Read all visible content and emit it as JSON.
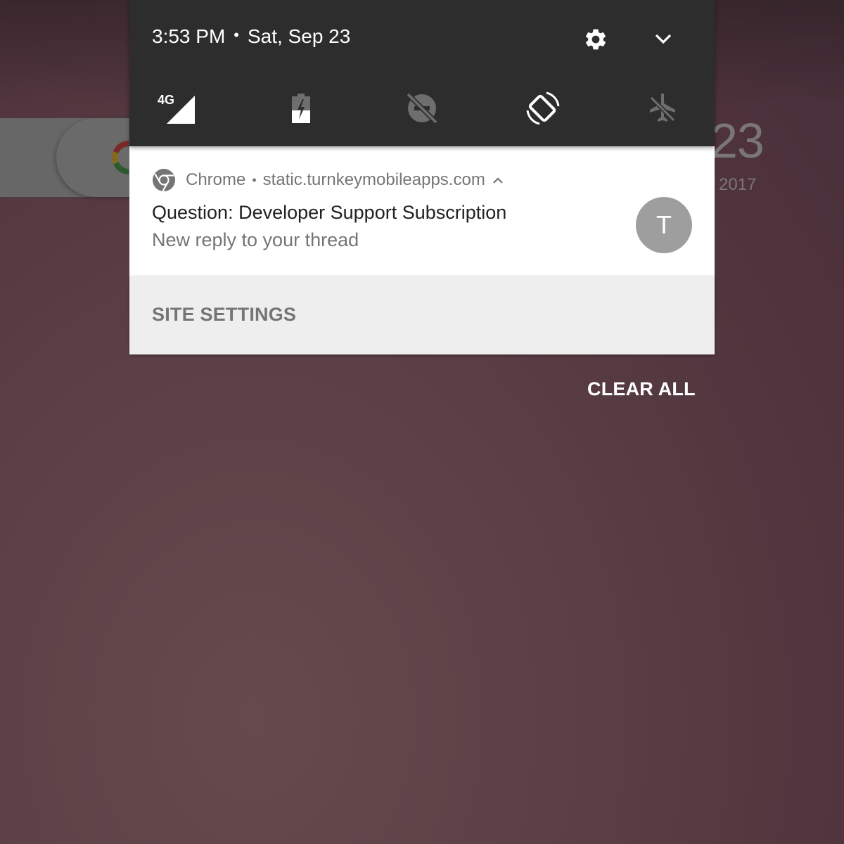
{
  "home": {
    "clock_partial": "23",
    "date_partial": "2017"
  },
  "shade": {
    "time": "3:53 PM",
    "separator": "•",
    "date": "Sat, Sep 23",
    "settings_icon": "gear-icon",
    "expand_icon": "chevron-down-icon",
    "quick_settings": [
      {
        "name": "mobile-data",
        "icon": "signal-4g-icon",
        "label": "4G",
        "state": "on"
      },
      {
        "name": "battery-saver",
        "icon": "battery-charging-icon",
        "state": "off"
      },
      {
        "name": "do-not-disturb",
        "icon": "dnd-off-icon",
        "state": "off"
      },
      {
        "name": "auto-rotate",
        "icon": "screen-rotation-icon",
        "state": "on"
      },
      {
        "name": "airplane-mode",
        "icon": "airplane-off-icon",
        "state": "off"
      }
    ]
  },
  "notification": {
    "app_name": "Chrome",
    "separator": "•",
    "source": "static.turnkeymobileapps.com",
    "title": "Question: Developer Support Subscription",
    "text": "New reply to your thread",
    "avatar_letter": "T",
    "action": "SITE SETTINGS"
  },
  "clear_all": "CLEAR ALL",
  "colors": {
    "shade_bg": "#2d2d2d",
    "card_bg": "#ffffff",
    "actions_bg": "#eeeeee",
    "secondary_text": "#757575",
    "primary_text": "#212121",
    "avatar_bg": "#9e9e9e",
    "inactive_icon": "#6e6e6e"
  }
}
